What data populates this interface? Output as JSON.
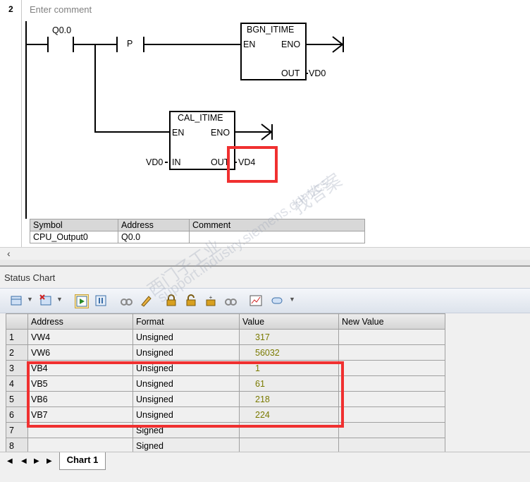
{
  "ladder": {
    "rung_number": "2",
    "comment_placeholder": "Enter comment",
    "contact_label": "Q0.0",
    "p_label": "P",
    "block1": {
      "title": "BGN_ITIME",
      "en": "EN",
      "eno": "ENO",
      "out": "OUT",
      "out_operand": "VD0"
    },
    "block2": {
      "title": "CAL_ITIME",
      "en": "EN",
      "eno": "ENO",
      "in": "IN",
      "in_operand": "VD0",
      "out": "OUT",
      "out_operand": "VD4"
    }
  },
  "symbol_table": {
    "headers": [
      "Symbol",
      "Address",
      "Comment"
    ],
    "rows": [
      [
        "CPU_Output0",
        "Q0.0",
        ""
      ]
    ]
  },
  "status_chart": {
    "title": "Status Chart",
    "headers": [
      "Address",
      "Format",
      "Value",
      "New Value"
    ],
    "rows": [
      {
        "n": "1",
        "address": "VW4",
        "format": "Unsigned",
        "value": "317",
        "new_value": ""
      },
      {
        "n": "2",
        "address": "VW6",
        "format": "Unsigned",
        "value": "56032",
        "new_value": ""
      },
      {
        "n": "3",
        "address": "VB4",
        "format": "Unsigned",
        "value": "1",
        "new_value": ""
      },
      {
        "n": "4",
        "address": "VB5",
        "format": "Unsigned",
        "value": "61",
        "new_value": ""
      },
      {
        "n": "5",
        "address": "VB6",
        "format": "Unsigned",
        "value": "218",
        "new_value": ""
      },
      {
        "n": "6",
        "address": "VB7",
        "format": "Unsigned",
        "value": "224",
        "new_value": ""
      },
      {
        "n": "7",
        "address": "",
        "format": "Signed",
        "value": "",
        "new_value": ""
      },
      {
        "n": "8",
        "address": "",
        "format": "Signed",
        "value": "",
        "new_value": ""
      }
    ],
    "tab_label": "Chart 1"
  },
  "watermark": {
    "text1": "找答案",
    "text2": "support.industry.siemens.com/cs",
    "text3": "西门子工业"
  },
  "colors": {
    "highlight": "#f03030",
    "value_text": "#7a7a00"
  }
}
